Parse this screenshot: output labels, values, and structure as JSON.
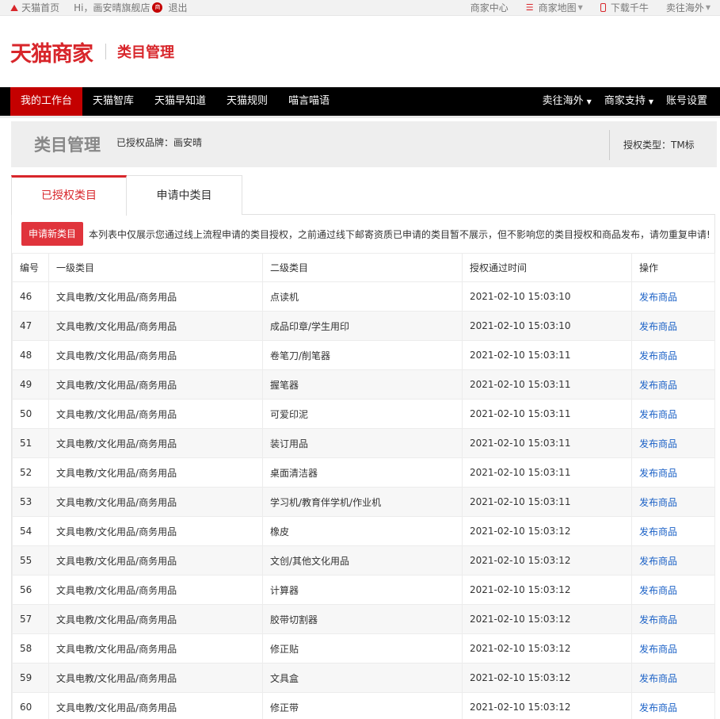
{
  "topbar": {
    "home_label": "天猫首页",
    "greeting": "Hi，画安晴旗舰店",
    "badge": "商",
    "logout": "退出",
    "links": [
      "商家中心",
      "商家地图",
      "下载千牛",
      "卖往海外"
    ]
  },
  "header": {
    "logo": "天猫商家",
    "title": "类目管理"
  },
  "nav": {
    "left": [
      "我的工作台",
      "天猫智库",
      "天猫早知道",
      "天猫规则",
      "喵言喵语"
    ],
    "right": [
      "卖往海外",
      "商家支持",
      "账号设置"
    ]
  },
  "banner": {
    "title": "类目管理",
    "brand": "已授权品牌：画安晴",
    "auth_type": "授权类型：TM标"
  },
  "tabs": [
    "已授权类目",
    "申请中类目"
  ],
  "notice": {
    "button": "申请新类目",
    "text": "本列表中仅展示您通过线上流程申请的类目授权，之前通过线下邮寄资质已申请的类目暂不展示，但不影响您的类目授权和商品发布，请勿重复申请!"
  },
  "table": {
    "headers": [
      "编号",
      "一级类目",
      "二级类目",
      "授权通过时间",
      "操作"
    ],
    "rows": [
      [
        "46",
        "文具电教/文化用品/商务用品",
        "点读机",
        "2021-02-10 15:03:10",
        "发布商品"
      ],
      [
        "47",
        "文具电教/文化用品/商务用品",
        "成品印章/学生用印",
        "2021-02-10 15:03:10",
        "发布商品"
      ],
      [
        "48",
        "文具电教/文化用品/商务用品",
        "卷笔刀/削笔器",
        "2021-02-10 15:03:11",
        "发布商品"
      ],
      [
        "49",
        "文具电教/文化用品/商务用品",
        "握笔器",
        "2021-02-10 15:03:11",
        "发布商品"
      ],
      [
        "50",
        "文具电教/文化用品/商务用品",
        "可爱印泥",
        "2021-02-10 15:03:11",
        "发布商品"
      ],
      [
        "51",
        "文具电教/文化用品/商务用品",
        "装订用品",
        "2021-02-10 15:03:11",
        "发布商品"
      ],
      [
        "52",
        "文具电教/文化用品/商务用品",
        "桌面清洁器",
        "2021-02-10 15:03:11",
        "发布商品"
      ],
      [
        "53",
        "文具电教/文化用品/商务用品",
        "学习机/教育伴学机/作业机",
        "2021-02-10 15:03:11",
        "发布商品"
      ],
      [
        "54",
        "文具电教/文化用品/商务用品",
        "橡皮",
        "2021-02-10 15:03:12",
        "发布商品"
      ],
      [
        "55",
        "文具电教/文化用品/商务用品",
        "文创/其他文化用品",
        "2021-02-10 15:03:12",
        "发布商品"
      ],
      [
        "56",
        "文具电教/文化用品/商务用品",
        "计算器",
        "2021-02-10 15:03:12",
        "发布商品"
      ],
      [
        "57",
        "文具电教/文化用品/商务用品",
        "胶带切割器",
        "2021-02-10 15:03:12",
        "发布商品"
      ],
      [
        "58",
        "文具电教/文化用品/商务用品",
        "修正贴",
        "2021-02-10 15:03:12",
        "发布商品"
      ],
      [
        "59",
        "文具电教/文化用品/商务用品",
        "文具盒",
        "2021-02-10 15:03:12",
        "发布商品"
      ],
      [
        "60",
        "文具电教/文化用品/商务用品",
        "修正带",
        "2021-02-10 15:03:12",
        "发布商品"
      ]
    ]
  },
  "colors": {
    "brand_red": "#d8262b",
    "nav_active": "#c40000",
    "link_blue": "#1a60c6"
  }
}
